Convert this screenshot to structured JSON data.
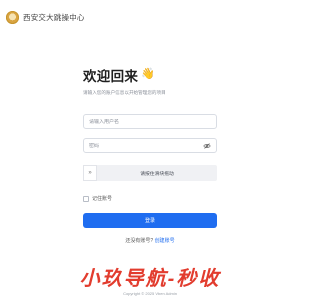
{
  "header": {
    "site_title": "西安交大跳操中心"
  },
  "login": {
    "title": "欢迎回来",
    "title_emoji": "👋",
    "subtitle": "请输入您的账户信息以开始管理您的项目",
    "username": {
      "placeholder": "请输入用户名",
      "value": ""
    },
    "password": {
      "placeholder": "密码",
      "value": ""
    },
    "slider": {
      "handle_glyph": "»",
      "text": "请按住滑块拖动"
    },
    "remember_label": "记住账号",
    "submit_label": "登录",
    "register_prompt": "还没有账号?",
    "register_link": "创建账号"
  },
  "overlay": {
    "watermark_text": "小玖导航-秒收"
  },
  "footer": {
    "copyright": "Copyright © 2025 Vben Admin"
  },
  "colors": {
    "primary": "#1f6df0",
    "watermark": "#e23c2e",
    "slider_bg": "#f0f1f4"
  },
  "icons": {
    "logo": "university-seal-logo",
    "password_toggle": "eye-off-icon",
    "slider_handle": "double-chevron-right-icon"
  }
}
